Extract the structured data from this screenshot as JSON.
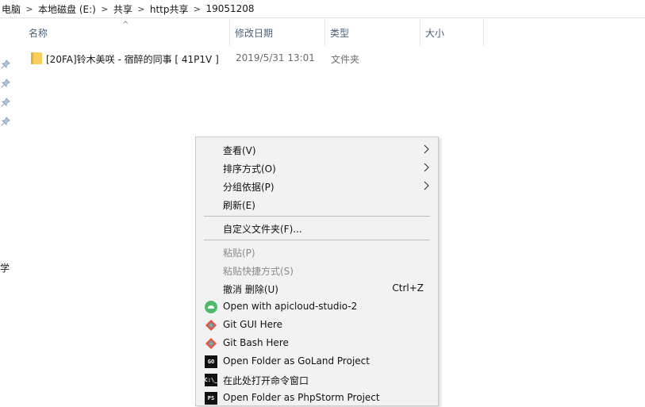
{
  "breadcrumb": {
    "items": [
      "电脑",
      "本地磁盘 (E:)",
      "共享",
      "http共享",
      "19051208"
    ],
    "separator": ">"
  },
  "nav": {
    "partial_label": "学"
  },
  "columns": {
    "name": "名称",
    "date": "修改日期",
    "type": "类型",
    "size": "大小",
    "sort_indicator": "^"
  },
  "files": [
    {
      "name": "[20FA]铃木美咲 - 宿醉的同事 [ 41P1V ]",
      "date": "2019/5/31 13:01",
      "type": "文件夹"
    }
  ],
  "context_menu": {
    "items": [
      {
        "label": "查看(V)",
        "submenu": true
      },
      {
        "label": "排序方式(O)",
        "submenu": true
      },
      {
        "label": "分组依据(P)",
        "submenu": true
      },
      {
        "label": "刷新(E)"
      },
      {
        "label": "自定义文件夹(F)..."
      },
      {
        "label": "粘贴(P)",
        "disabled": true
      },
      {
        "label": "粘贴快捷方式(S)",
        "disabled": true
      },
      {
        "label": "撤消 删除(U)",
        "shortcut": "Ctrl+Z"
      },
      {
        "label": "Open with apicloud-studio-2",
        "icon": "apicloud-icon"
      },
      {
        "label": "Git GUI Here",
        "icon": "git-icon"
      },
      {
        "label": "Git Bash Here",
        "icon": "git-icon"
      },
      {
        "label": "Open Folder as GoLand Project",
        "icon": "goland-icon",
        "icon_text": "GO"
      },
      {
        "label": "在此处打开命令窗口",
        "icon": "cmd-icon",
        "icon_text": "C:\\_"
      },
      {
        "label": "Open Folder as PhpStorm Project",
        "icon": "phpstorm-icon",
        "icon_text": "PS"
      }
    ]
  },
  "colors": {
    "header_text": "#4c607a",
    "folder": "#f6cf5e",
    "menu_bg": "#f2f2f2",
    "git": "#f05133",
    "apicloud": "#4fba6a"
  }
}
